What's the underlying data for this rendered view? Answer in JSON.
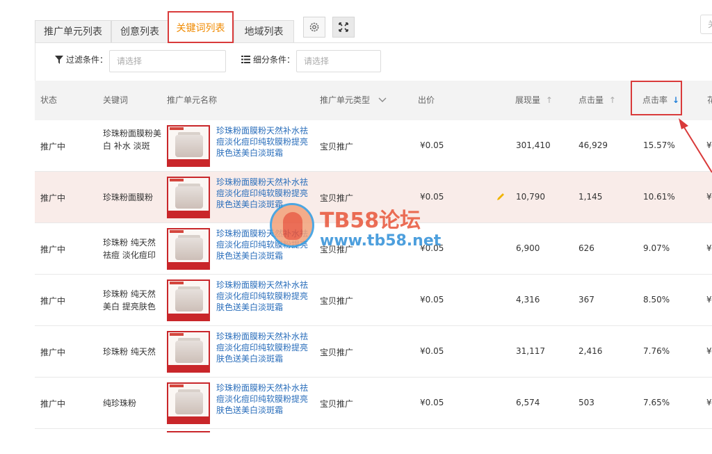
{
  "tabs": [
    {
      "label": "推广单元列表",
      "active": false
    },
    {
      "label": "创意列表",
      "active": false
    },
    {
      "label": "关键词列表",
      "active": true
    },
    {
      "label": "地域列表",
      "active": false
    }
  ],
  "toolbar": {
    "settings_icon": "gear-icon",
    "fullscreen_icon": "expand-icon",
    "right_stub": "关"
  },
  "filters": {
    "filter_label": "过滤条件：",
    "filter_placeholder": "请选择",
    "breakdown_label": "细分条件：",
    "breakdown_placeholder": "请选择"
  },
  "columns": {
    "status": "状态",
    "keyword": "关键词",
    "unit_name": "推广单元名称",
    "unit_type": "推广单元类型",
    "bid": "出价",
    "impressions": "展现量",
    "clicks": "点击量",
    "ctr": "点击率",
    "next": "花"
  },
  "rows": [
    {
      "status": "推广中",
      "keyword": "珍珠粉面膜粉美白 补水 淡斑",
      "title": "珍珠粉面膜粉天然补水祛痘淡化痘印纯软膜粉提亮肤色送美白淡斑霜",
      "type": "宝贝推广",
      "bid": "¥0.05",
      "impressions": "301,410",
      "clicks": "46,929",
      "ctr": "15.57%",
      "next": "¥"
    },
    {
      "status": "推广中",
      "keyword": "珍珠粉面膜粉",
      "title": "珍珠粉面膜粉天然补水祛痘淡化痘印纯软膜粉提亮肤色送美白淡斑霜",
      "type": "宝贝推广",
      "bid": "¥0.05",
      "impressions": "10,790",
      "clicks": "1,145",
      "ctr": "10.61%",
      "next": "¥"
    },
    {
      "status": "推广中",
      "keyword": "珍珠粉 纯天然 祛痘 淡化痘印",
      "title": "珍珠粉面膜粉天然补水祛痘淡化痘印纯软膜粉提亮肤色送美白淡斑霜",
      "type": "宝贝推广",
      "bid": "¥0.05",
      "impressions": "6,900",
      "clicks": "626",
      "ctr": "9.07%",
      "next": "¥"
    },
    {
      "status": "推广中",
      "keyword": "珍珠粉 纯天然 美白 提亮肤色",
      "title": "珍珠粉面膜粉天然补水祛痘淡化痘印纯软膜粉提亮肤色送美白淡斑霜",
      "type": "宝贝推广",
      "bid": "¥0.05",
      "impressions": "4,316",
      "clicks": "367",
      "ctr": "8.50%",
      "next": "¥"
    },
    {
      "status": "推广中",
      "keyword": "珍珠粉 纯天然",
      "title": "珍珠粉面膜粉天然补水祛痘淡化痘印纯软膜粉提亮肤色送美白淡斑霜",
      "type": "宝贝推广",
      "bid": "¥0.05",
      "impressions": "31,117",
      "clicks": "2,416",
      "ctr": "7.76%",
      "next": "¥"
    },
    {
      "status": "推广中",
      "keyword": "纯珍珠粉",
      "title": "珍珠粉面膜粉天然补水祛痘淡化痘印纯软膜粉提亮肤色送美白淡斑霜",
      "type": "宝贝推广",
      "bid": "¥0.05",
      "impressions": "6,574",
      "clicks": "503",
      "ctr": "7.65%",
      "next": "¥"
    }
  ],
  "watermark": {
    "title": "TB58论坛",
    "url": "www.tb58.net"
  },
  "colors": {
    "accent_orange": "#f08a00",
    "highlight_red": "#d93a3a",
    "link_blue": "#2a6ebb",
    "row_highlight": "#f9ece9"
  }
}
